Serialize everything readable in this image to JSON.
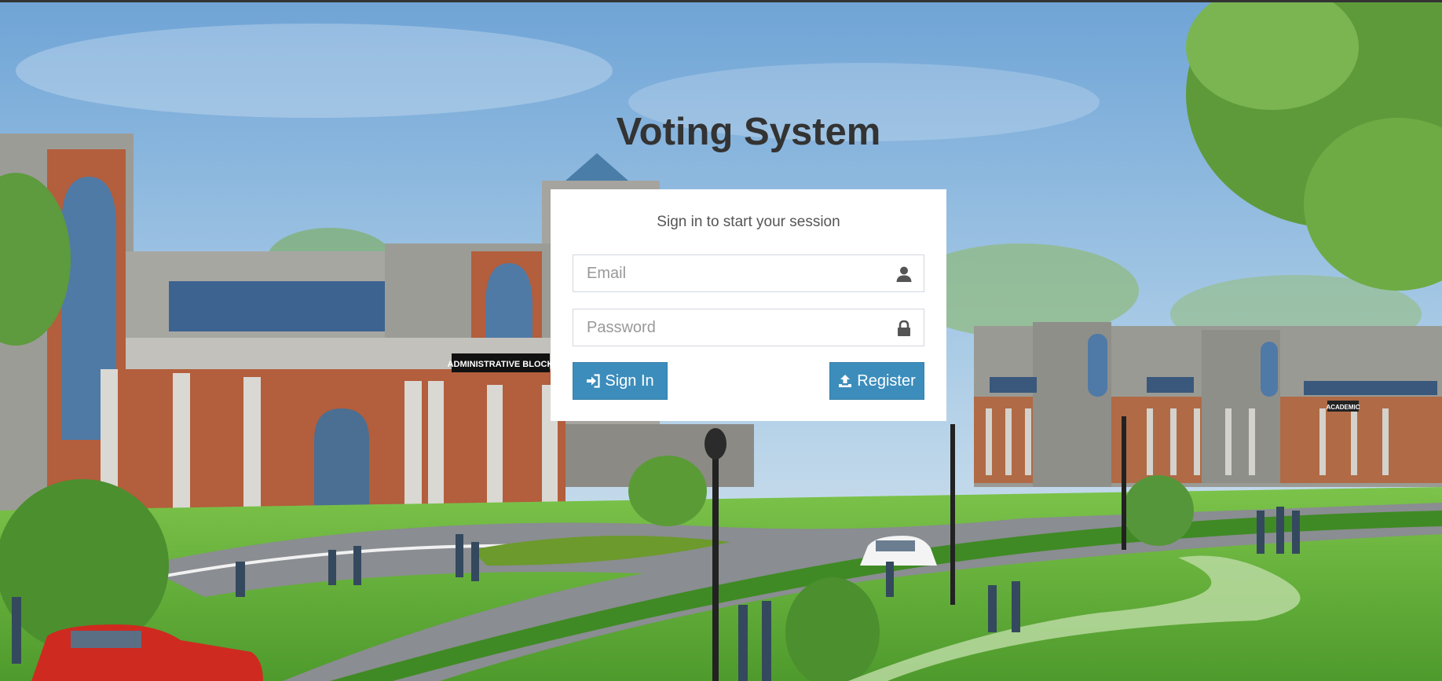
{
  "page": {
    "title": "Voting System"
  },
  "login": {
    "message": "Sign in to start your session",
    "email": {
      "value": "",
      "placeholder": "Email",
      "icon": "user-icon"
    },
    "password": {
      "value": "",
      "placeholder": "Password",
      "icon": "lock-icon"
    },
    "signin_button": {
      "label": "Sign In",
      "icon": "sign-in-icon"
    },
    "register_button": {
      "label": "Register",
      "icon": "upload-icon"
    }
  },
  "background": {
    "sign_text": "ADMINISTRATIVE BLOCK",
    "sign_text_2": "ACADEMIC"
  },
  "colors": {
    "primary": "#3c8dbc",
    "title": "#333333",
    "box_bg": "#ffffff"
  }
}
